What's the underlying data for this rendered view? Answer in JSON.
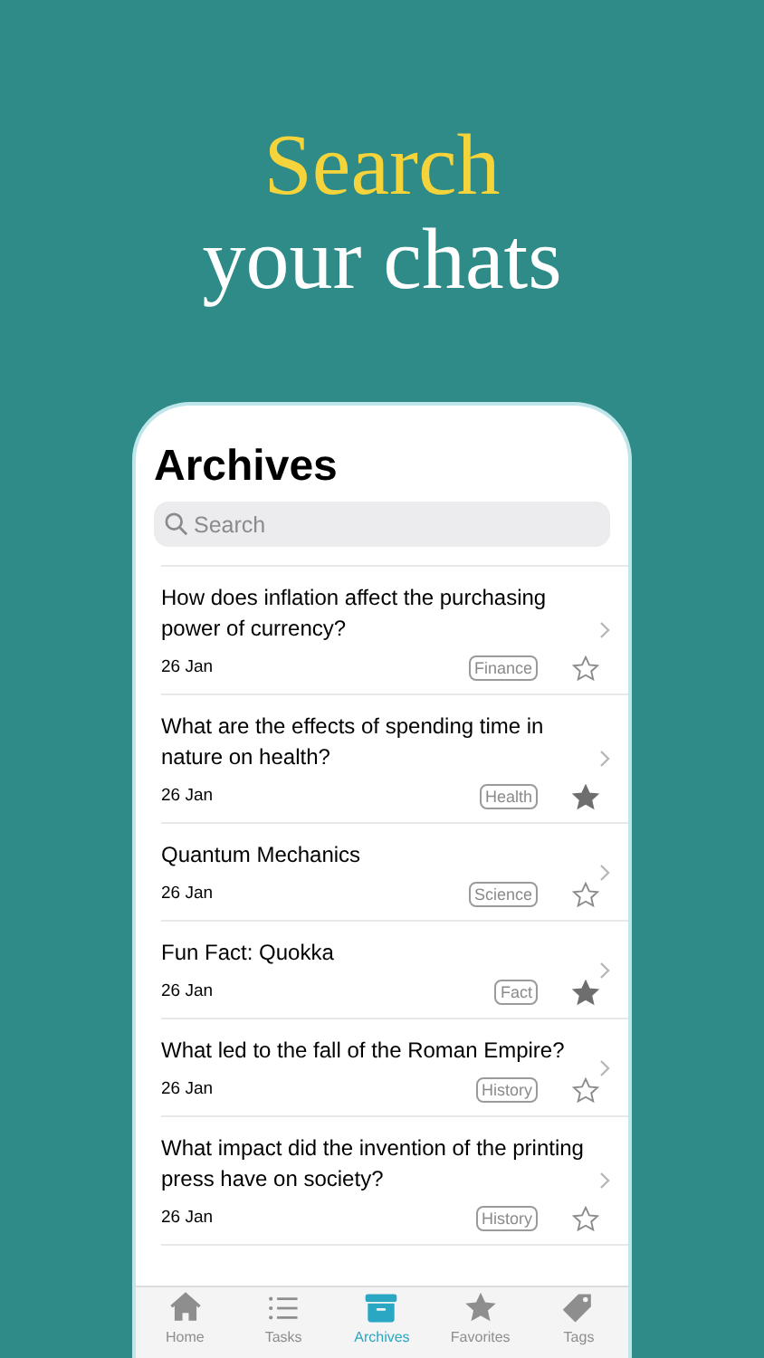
{
  "headline": {
    "line_1": "Search",
    "line_2": "your chats"
  },
  "screen": {
    "title": "Archives",
    "search": {
      "placeholder": "Search"
    },
    "chats": [
      {
        "title": "How does inflation affect the purchasing power of currency?",
        "date": "26 Jan",
        "tag": "Finance",
        "favorite": false
      },
      {
        "title": "What are the effects of spending time in nature on health?",
        "date": "26 Jan",
        "tag": "Health",
        "favorite": true
      },
      {
        "title": "Quantum Mechanics",
        "date": "26 Jan",
        "tag": "Science",
        "favorite": false
      },
      {
        "title": "Fun Fact: Quokka",
        "date": "26 Jan",
        "tag": "Fact",
        "favorite": true
      },
      {
        "title": "What led to the fall of the Roman Empire?",
        "date": "26 Jan",
        "tag": "History",
        "favorite": false
      },
      {
        "title": "What impact did the invention of the printing press have on society?",
        "date": "26 Jan",
        "tag": "History",
        "favorite": false
      }
    ],
    "tab_bar": [
      {
        "kind": "home",
        "label": "Home",
        "selected": false
      },
      {
        "kind": "tasks",
        "label": "Tasks",
        "selected": false
      },
      {
        "kind": "archives",
        "label": "Archives",
        "selected": true
      },
      {
        "kind": "favorites",
        "label": "Favorites",
        "selected": false
      },
      {
        "kind": "tags",
        "label": "Tags",
        "selected": false
      }
    ]
  }
}
